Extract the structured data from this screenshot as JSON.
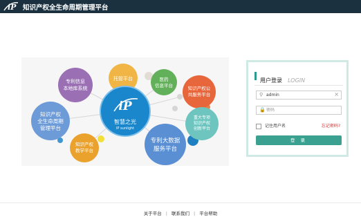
{
  "header": {
    "title": "知识产权全生命周期管理平台",
    "logo_text": "iP"
  },
  "hero": {
    "center_lines": [
      "智慧之光",
      "IP sunlight"
    ],
    "center_logo": "iP",
    "bubbles": [
      {
        "lines": [
          "专利信息",
          "本地库系统"
        ],
        "color": "#9a6fb4"
      },
      {
        "lines": [
          "托管平台"
        ],
        "color": "#f0b545"
      },
      {
        "lines": [
          "医药",
          "信息平台"
        ],
        "color": "#62b05a"
      },
      {
        "lines": [
          "知识产权公",
          "共服务平台"
        ],
        "color": "#e8663b"
      },
      {
        "lines": [
          "重大专项",
          "知识产权",
          "创新平台"
        ],
        "color": "#6ec5bf"
      },
      {
        "lines": [
          "专利大数据",
          "服务平台"
        ],
        "color": "#5b8fd4"
      },
      {
        "lines": [
          "知识产权",
          "教学平台"
        ],
        "color": "#eba22c"
      },
      {
        "lines": [
          "知识产权",
          "全生命周期",
          "管理平台"
        ],
        "color": "#6d9bd8"
      }
    ]
  },
  "login": {
    "title": "用户登录",
    "subtitle": "LOGIN",
    "username_value": "admin",
    "password_placeholder": "密码",
    "remember_label": "记住用户名",
    "forgot_label": "忘记密码?",
    "submit_label": "登 录"
  },
  "footer": {
    "links": [
      "关于平台",
      "联系我们",
      "平台帮助"
    ]
  }
}
